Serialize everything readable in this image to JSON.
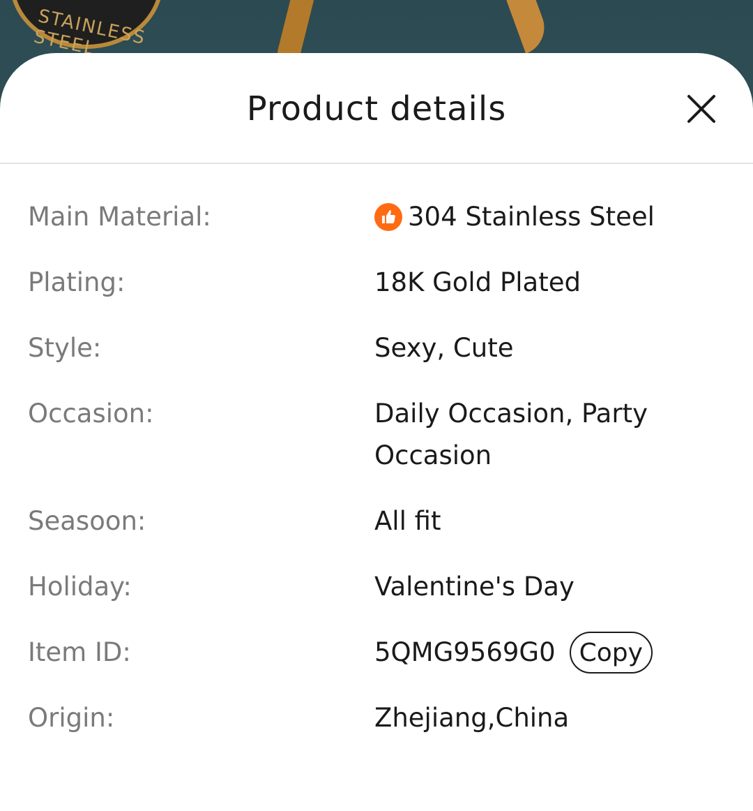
{
  "backdrop": {
    "badge_text": "STAINLESS STEEL"
  },
  "sheet": {
    "title": "Product details",
    "close_icon": "close-icon"
  },
  "details": [
    {
      "label": "Main Material:",
      "value": "304 Stainless Steel",
      "icon": "thumbs-up-icon",
      "icon_color": "#ff6a13"
    },
    {
      "label": "Plating:",
      "value": "18K Gold Plated"
    },
    {
      "label": "Style:",
      "value": "Sexy, Cute"
    },
    {
      "label": "Occasion:",
      "value": "Daily Occasion, Party Occasion"
    },
    {
      "label": "Seasoon:",
      "value": "All fit"
    },
    {
      "label": "Holiday:",
      "value": "Valentine's Day"
    },
    {
      "label": "Item ID:",
      "value": "5QMG9569G0",
      "action_label": "Copy"
    },
    {
      "label": "Origin:",
      "value": "Zhejiang,China"
    }
  ]
}
